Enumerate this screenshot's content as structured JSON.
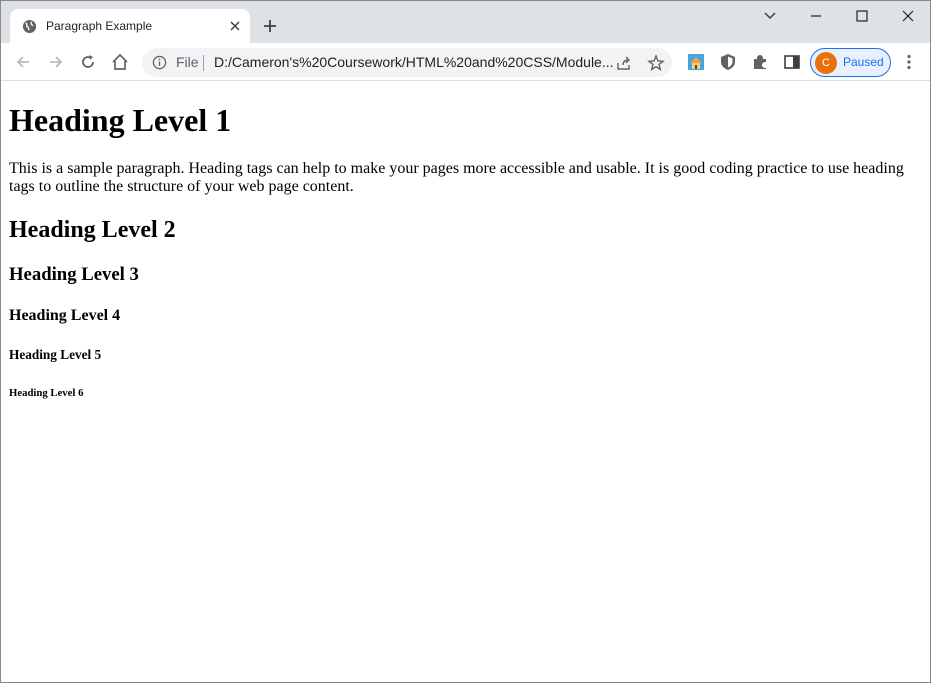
{
  "browser": {
    "tab_title": "Paragraph Example",
    "address_prefix": "File",
    "url": "D:/Cameron's%20Coursework/HTML%20and%20CSS/Module...",
    "profile_initial": "C",
    "profile_status": "Paused",
    "accent_color": "#1a73e8",
    "avatar_color": "#e8710a"
  },
  "page": {
    "heading1": "Heading Level 1",
    "paragraph": "This is a sample paragraph. Heading tags can help to make your pages more accessible and usable. It is good coding practice to use heading tags to outline the structure of your web page content.",
    "heading2": "Heading Level 2",
    "heading3": "Heading Level 3",
    "heading4": "Heading Level 4",
    "heading5": "Heading Level 5",
    "heading6": "Heading Level 6"
  }
}
